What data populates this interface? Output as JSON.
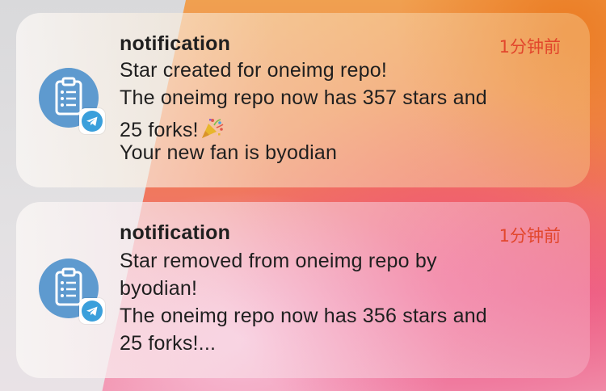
{
  "colors": {
    "time_text": "#e2462c",
    "app_icon_bg": "#5e9acf",
    "telegram_blue": "#3a9fdb"
  },
  "notifications": [
    {
      "app_name": "notification",
      "time": "1分钟前",
      "app_icon": "clipboard-checklist-icon",
      "badge_icon": "telegram-icon",
      "lines": [
        "Star created for oneimg repo!",
        "The oneimg repo now has 357 stars and",
        "25 forks!",
        "Your new fan is byodian"
      ],
      "emoji": "party-popper-icon"
    },
    {
      "app_name": "notification",
      "time": "1分钟前",
      "app_icon": "clipboard-checklist-icon",
      "badge_icon": "telegram-icon",
      "lines": [
        "Star removed from oneimg repo by",
        "byodian!",
        "The oneimg repo now has 356 stars and",
        "25 forks!..."
      ]
    }
  ]
}
